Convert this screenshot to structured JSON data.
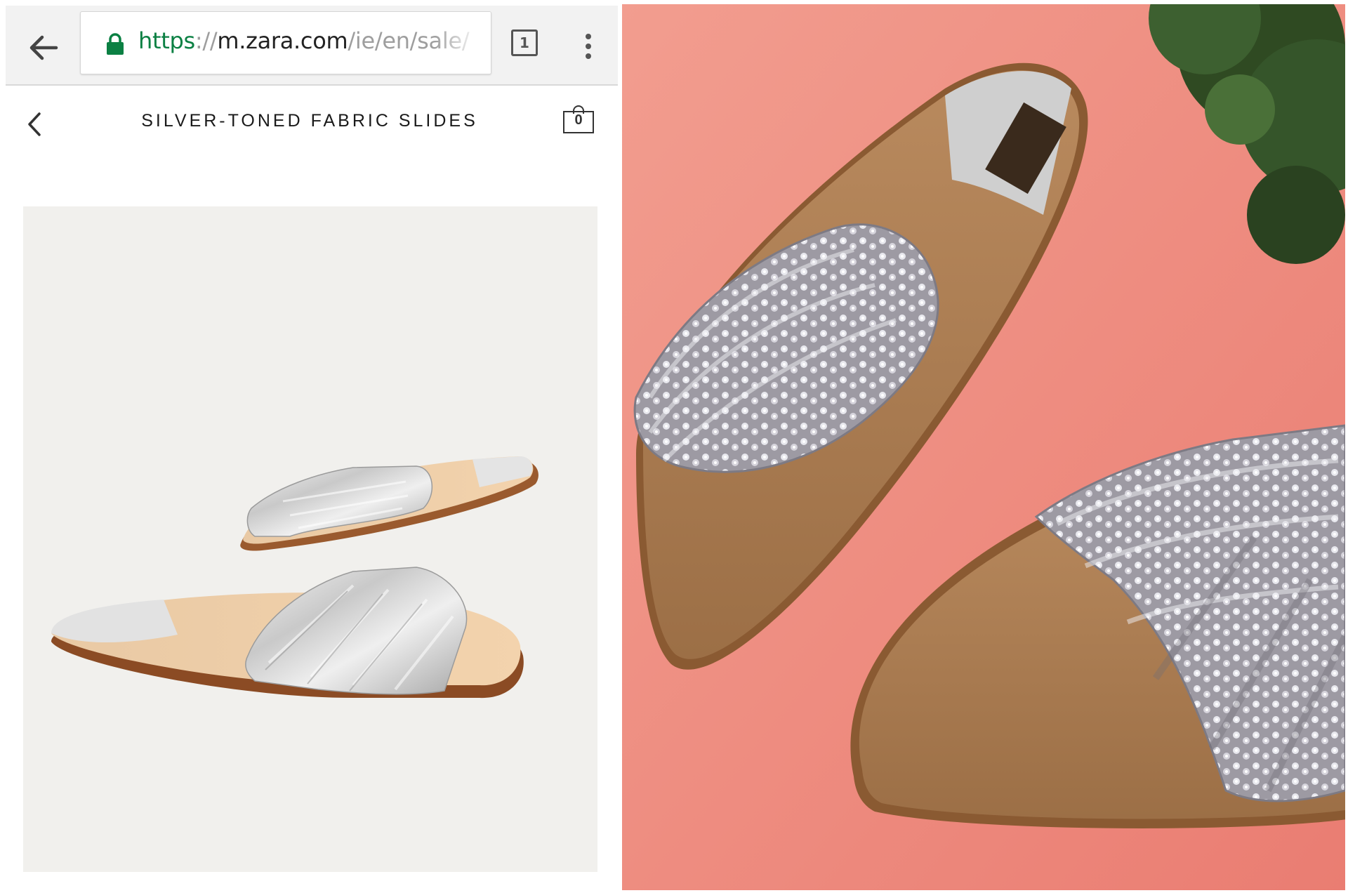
{
  "browser": {
    "url_scheme": "https",
    "url_separator": "://",
    "url_host": "m.zara.com",
    "url_path": "/ie/en/sale/",
    "tab_count": "1",
    "lock_color": "#0b8043"
  },
  "page": {
    "title": "SILVER-TONED FABRIC SLIDES",
    "cart_count": "0"
  },
  "icons": {
    "browser_back": "arrow-left-icon",
    "secure": "lock-icon",
    "tabs": "tab-switcher-icon",
    "menu": "more-vert-icon",
    "page_back": "chevron-left-icon",
    "cart": "shopping-bag-icon"
  },
  "colors": {
    "photo_background": "#f08f82",
    "product_background": "#f1f0ed"
  }
}
